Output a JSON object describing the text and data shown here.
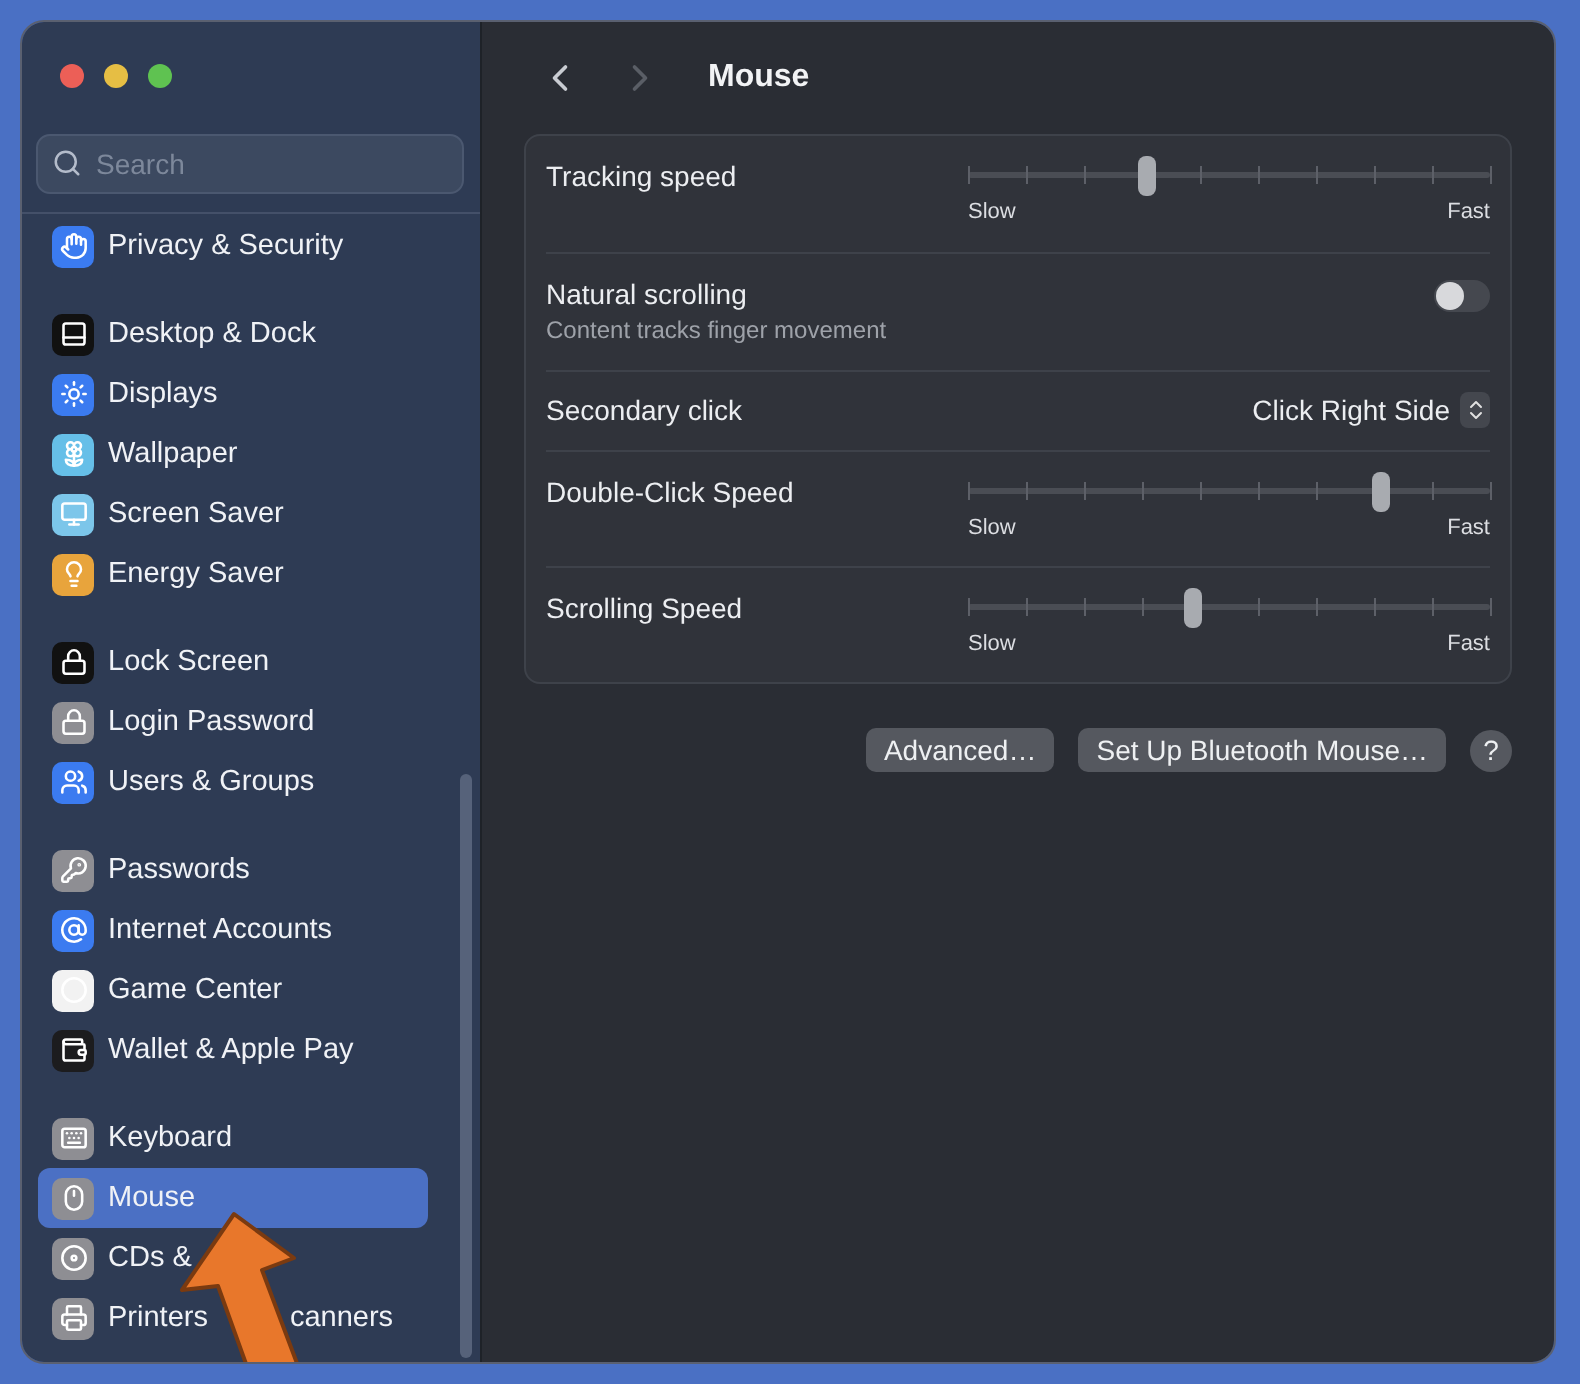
{
  "window": {
    "title": "Mouse"
  },
  "sidebar": {
    "search": {
      "placeholder": "Search"
    },
    "groups": [
      {
        "items": [
          {
            "label": "Privacy & Security",
            "color": "#3b7bf0",
            "selected": false
          }
        ]
      },
      {
        "items": [
          {
            "label": "Desktop & Dock",
            "color": "#111111",
            "selected": false
          },
          {
            "label": "Displays",
            "color": "#3b7bf0",
            "selected": false
          },
          {
            "label": "Wallpaper",
            "color": "#66bfe8",
            "selected": false
          },
          {
            "label": "Screen Saver",
            "color": "#7cc6ea",
            "selected": false
          },
          {
            "label": "Energy Saver",
            "color": "#e8a43c",
            "selected": false
          }
        ]
      },
      {
        "items": [
          {
            "label": "Lock Screen",
            "color": "#111111",
            "selected": false
          },
          {
            "label": "Login Password",
            "color": "#8e8e93",
            "selected": false
          },
          {
            "label": "Users & Groups",
            "color": "#3b7bf0",
            "selected": false
          }
        ]
      },
      {
        "items": [
          {
            "label": "Passwords",
            "color": "#8e8e93",
            "selected": false
          },
          {
            "label": "Internet Accounts",
            "color": "#3b7bf0",
            "selected": false
          },
          {
            "label": "Game Center",
            "color": "#f2f2f2",
            "selected": false
          },
          {
            "label": "Wallet & Apple Pay",
            "color": "#1c1c1e",
            "selected": false
          }
        ]
      },
      {
        "items": [
          {
            "label": "Keyboard",
            "color": "#8e8e93",
            "selected": false
          },
          {
            "label": "Mouse",
            "color": "#8e8e93",
            "selected": true
          },
          {
            "label": "CDs &",
            "color": "#8e8e93",
            "selected": false
          },
          {
            "label": "Printers",
            "tail": "canners",
            "color": "#8e8e93",
            "selected": false
          }
        ]
      }
    ]
  },
  "settings": [
    {
      "kind": "slider",
      "label": "Tracking speed",
      "level": 0.34,
      "min_label": "Slow",
      "max_label": "Fast"
    },
    {
      "kind": "toggle",
      "label": "Natural scrolling",
      "description": "Content tracks finger movement",
      "on": false
    },
    {
      "kind": "select",
      "label": "Secondary click",
      "value": "Click Right Side"
    },
    {
      "kind": "slider",
      "label": "Double-Click Speed",
      "level": 0.79,
      "min_label": "Slow",
      "max_label": "Fast"
    },
    {
      "kind": "slider",
      "label": "Scrolling Speed",
      "level": 0.43,
      "min_label": "Slow",
      "max_label": "Fast"
    }
  ],
  "buttons": [
    "Advanced…",
    "Set Up Bluetooth Mouse…"
  ],
  "help_button": "?"
}
